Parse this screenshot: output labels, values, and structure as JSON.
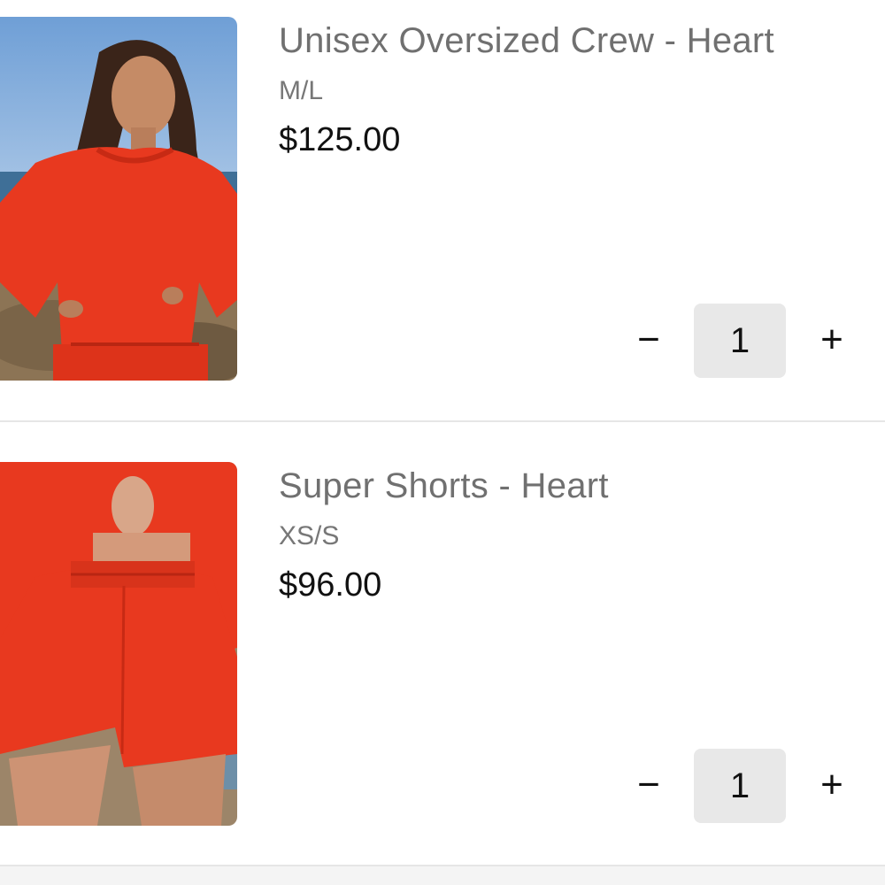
{
  "cart": {
    "items": [
      {
        "title": "Unisex Oversized Crew - Heart",
        "variant": "M/L",
        "price": "$125.00",
        "quantity": "1",
        "minus_symbol": "−",
        "plus_symbol": "+",
        "image_icon": "product-photo-red-crewneck"
      },
      {
        "title": "Super Shorts - Heart",
        "variant": "XS/S",
        "price": "$96.00",
        "quantity": "1",
        "minus_symbol": "−",
        "plus_symbol": "+",
        "image_icon": "product-photo-red-shorts"
      }
    ]
  },
  "colors": {
    "product_red": "#e8391f",
    "quantity_bg": "#e8e8e8",
    "title_gray": "#707070",
    "price_black": "#111111",
    "divider": "#e6e6e6"
  }
}
